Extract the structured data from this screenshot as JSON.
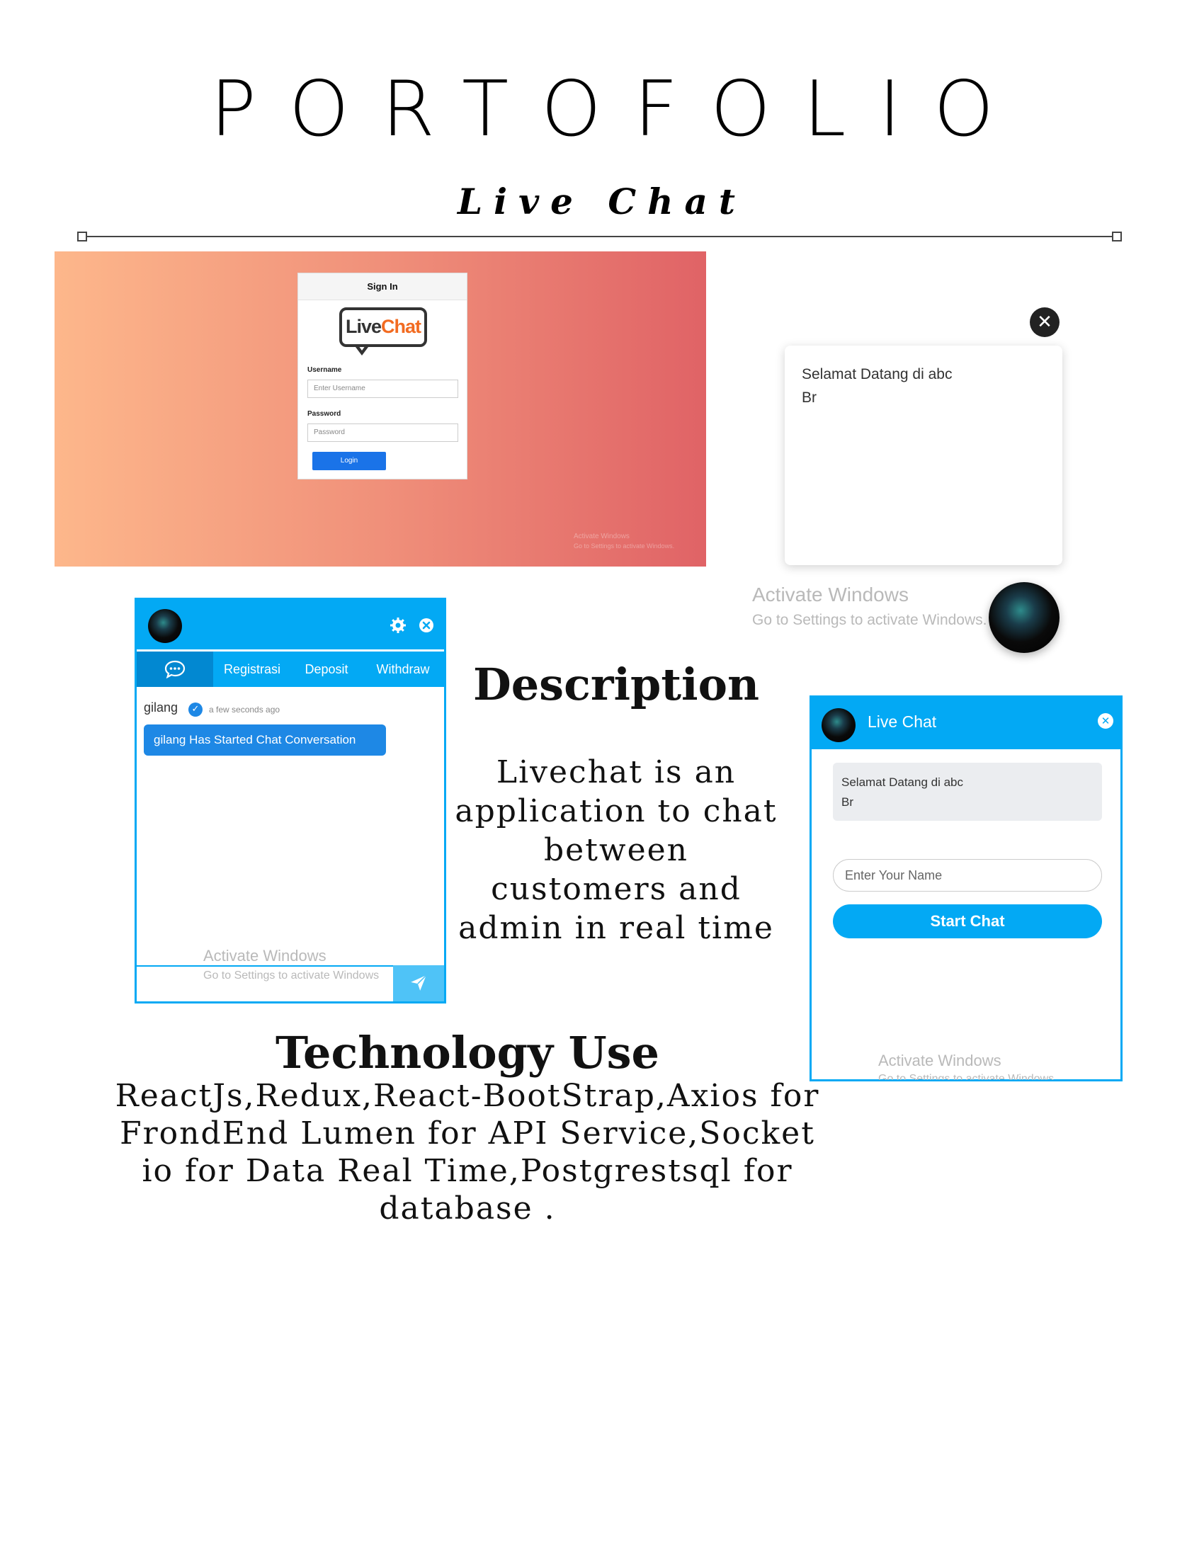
{
  "header": {
    "title": "PORTOFOLIO",
    "subtitle": "Live Chat"
  },
  "login_screen": {
    "card_title": "Sign In",
    "logo_live": "Live",
    "logo_chat": "Chat",
    "username_label": "Username",
    "username_placeholder": "Enter Username",
    "password_label": "Password",
    "password_placeholder": "Password",
    "login_button": "Login",
    "watermark_line1": "Activate Windows",
    "watermark_line2": "Go to Settings to activate Windows."
  },
  "welcome_popup": {
    "close_symbol": "✕",
    "message_line1": "Selamat Datang di abc",
    "message_line2": "Br",
    "watermark_line1": "Activate Windows",
    "watermark_line2": "Go to Settings to activate Windows."
  },
  "chat_window": {
    "nav_items": [
      "Registrasi",
      "Deposit",
      "Withdraw"
    ],
    "user_name": "gilang",
    "timestamp": "a few seconds ago",
    "message": "gilang Has Started Chat Conversation",
    "watermark_line1": "Activate Windows",
    "watermark_line2": "Go to Settings to activate Windows"
  },
  "description": {
    "title": "Description",
    "body": "Livechat is an application to chat between customers and admin in real time"
  },
  "live_chat_window": {
    "title": "Live Chat",
    "message_line1": "Selamat Datang di abc",
    "message_line2": "Br",
    "name_placeholder": "Enter Your Name",
    "start_button": "Start Chat",
    "watermark_line1": "Activate Windows",
    "watermark_line2": "Go to Settings to activate Windows."
  },
  "technology": {
    "title": "Technology Use",
    "body": "ReactJs,Redux,React-BootStrap,Axios for FrondEnd Lumen for API Service,Socket io for Data Real Time,Postgrestsql for database ."
  },
  "colors": {
    "accent_blue": "#03a9f4",
    "gradient_start": "#fdb78b",
    "gradient_end": "#e06366"
  }
}
